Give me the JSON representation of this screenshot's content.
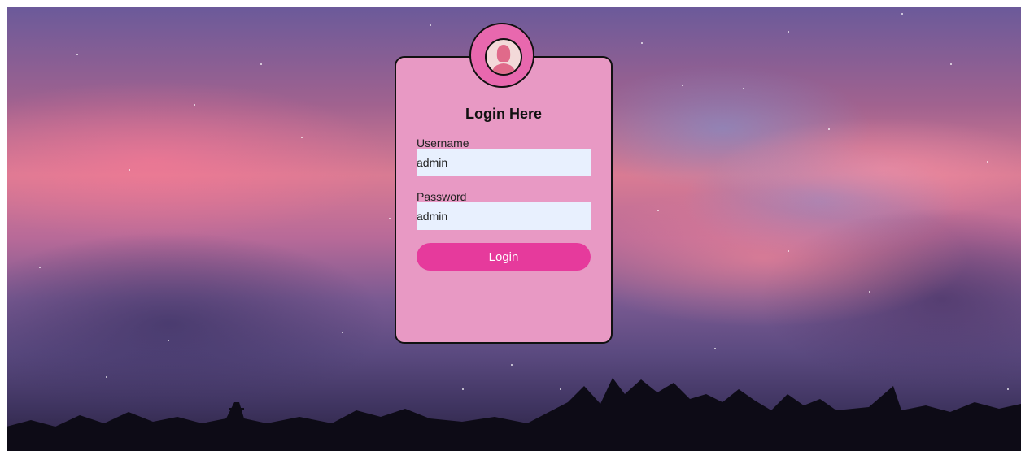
{
  "login_card": {
    "title": "Login Here",
    "username_label": "Username",
    "username_value": "admin",
    "password_label": "Password",
    "password_value": "admin",
    "login_button": "Login"
  },
  "colors": {
    "card_background": "#e899c4",
    "avatar_ring": "#e868ae",
    "button": "#e63a9c",
    "input_background": "#e8f0fe"
  },
  "icons": {
    "avatar": "user-avatar-icon"
  }
}
